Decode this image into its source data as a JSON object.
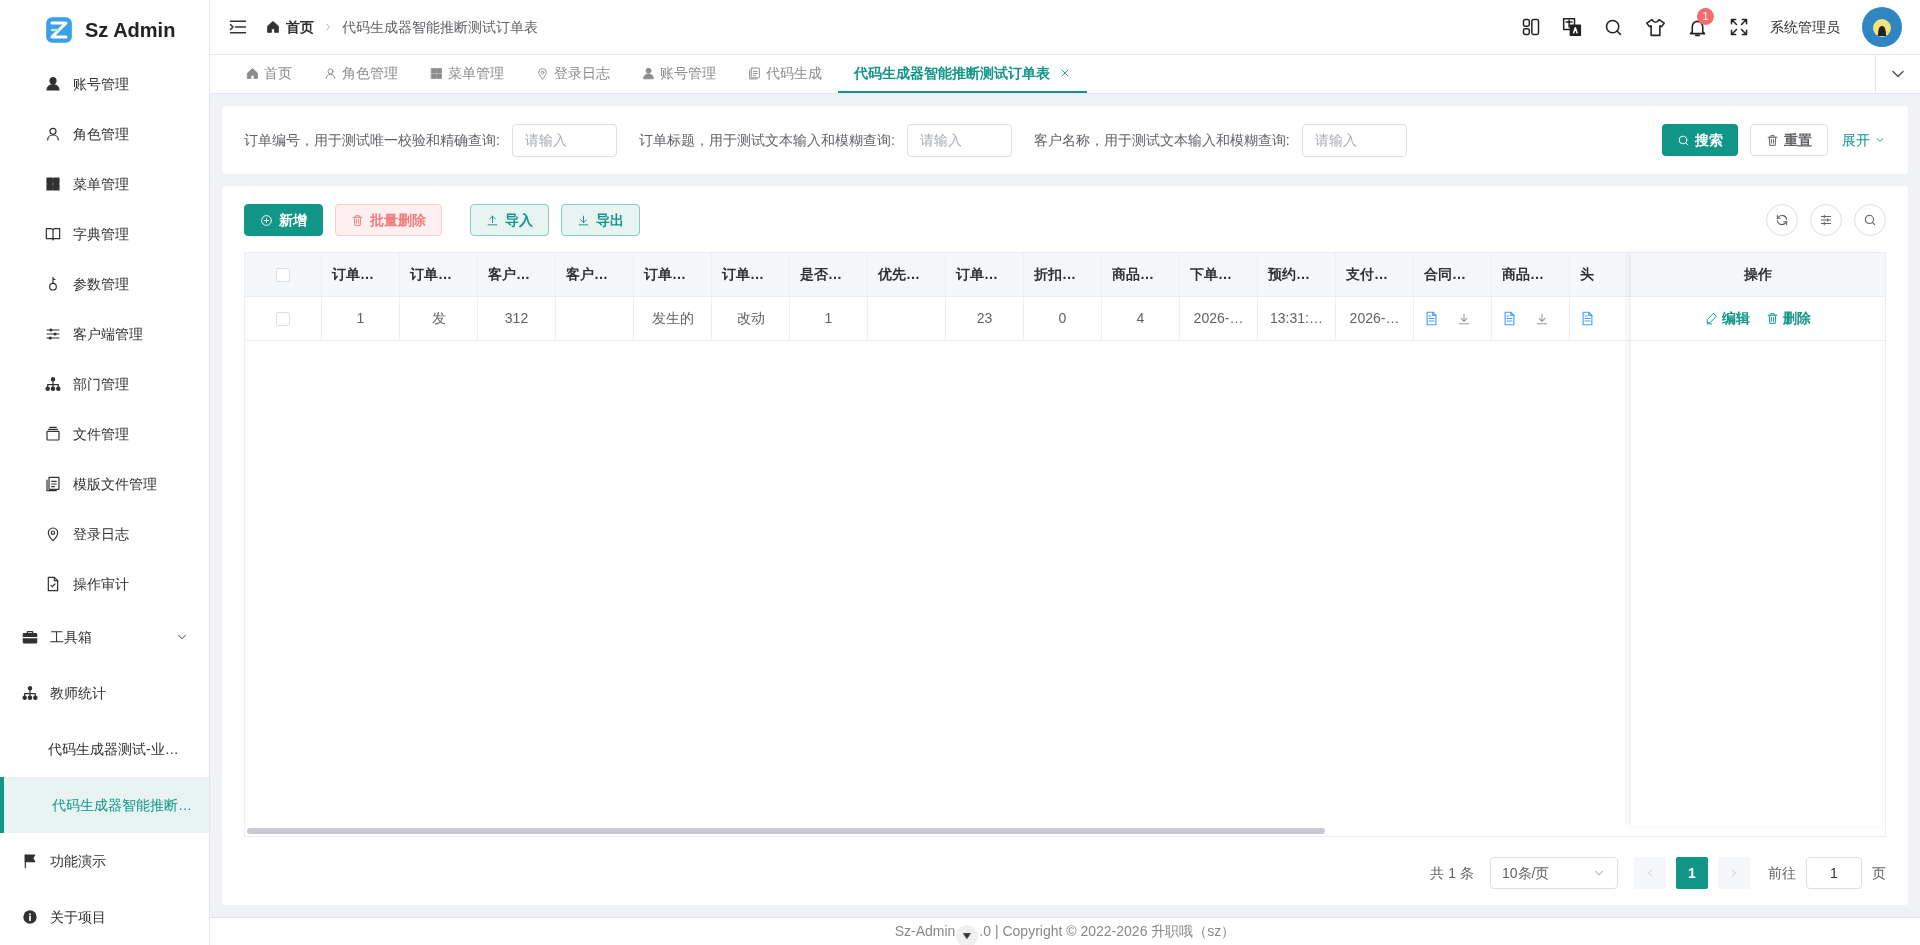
{
  "brand": {
    "name": "Sz Admin"
  },
  "sidebar": {
    "items": [
      {
        "children": [
          {
            "label": "账号管理"
          },
          {
            "label": "角色管理"
          },
          {
            "label": "菜单管理"
          },
          {
            "label": "字典管理"
          },
          {
            "label": "参数管理"
          },
          {
            "label": "客户端管理"
          },
          {
            "label": "部门管理"
          },
          {
            "label": "文件管理"
          },
          {
            "label": "模版文件管理"
          },
          {
            "label": "登录日志"
          },
          {
            "label": "操作审计"
          }
        ]
      },
      {
        "label": "工具箱",
        "expanded": false
      },
      {
        "label": "教师统计",
        "expanded": true,
        "children": [
          {
            "label": "代码生成器测试-业…",
            "selected": false
          },
          {
            "label": "代码生成器智能推断…",
            "selected": true
          }
        ]
      },
      {
        "label": "功能演示"
      },
      {
        "label": "关于项目"
      }
    ]
  },
  "header": {
    "breadcrumb": [
      "首页",
      "代码生成器智能推断测试订单表"
    ],
    "notification_count": "1",
    "user": "系统管理员"
  },
  "tabs": [
    {
      "label": "首页",
      "selected": false
    },
    {
      "label": "角色管理",
      "selected": false
    },
    {
      "label": "菜单管理",
      "selected": false
    },
    {
      "label": "登录日志",
      "selected": false
    },
    {
      "label": "账号管理",
      "selected": false
    },
    {
      "label": "代码生成",
      "selected": false
    },
    {
      "label": "代码生成器智能推断测试订单表",
      "selected": true
    }
  ],
  "search": {
    "fields": [
      {
        "label": "订单编号，用于测试唯一校验和精确查询:",
        "placeholder": "请输入"
      },
      {
        "label": "订单标题，用于测试文本输入和模糊查询:",
        "placeholder": "请输入"
      },
      {
        "label": "客户名称，用于测试文本输入和模糊查询:",
        "placeholder": "请输入"
      }
    ],
    "search_button": "搜索",
    "reset_button": "重置",
    "expand_link": "展开"
  },
  "toolbar": [
    {
      "label": "新增",
      "kind": "primary",
      "disabled": false
    },
    {
      "label": "批量删除",
      "kind": "danger",
      "disabled": true
    },
    {
      "label": "导入",
      "kind": "plain",
      "disabled": false
    },
    {
      "label": "导出",
      "kind": "plain",
      "disabled": false
    }
  ],
  "table": {
    "select_all_checked": false,
    "columns": [
      "订单…",
      "订单…",
      "客户…",
      "客户…",
      "订单…",
      "订单…",
      "是否…",
      "优先…",
      "订单…",
      "折扣…",
      "商品…",
      "下单…",
      "预约…",
      "支付…",
      "合同…",
      "商品…",
      "头"
    ],
    "actions_column": "操作",
    "rows": [
      {
        "checked": false,
        "cells": [
          {
            "kind": "text",
            "text": "1"
          },
          {
            "kind": "text",
            "text": "发"
          },
          {
            "kind": "text",
            "text": "312"
          },
          {
            "kind": "empty"
          },
          {
            "kind": "text",
            "text": "发生的"
          },
          {
            "kind": "text",
            "text": "改动"
          },
          {
            "kind": "text",
            "text": "1"
          },
          {
            "kind": "empty"
          },
          {
            "kind": "text",
            "text": "23"
          },
          {
            "kind": "text",
            "text": "0"
          },
          {
            "kind": "text",
            "text": "4"
          },
          {
            "kind": "text",
            "text": "2026-…"
          },
          {
            "kind": "text",
            "text": "13:31:…"
          },
          {
            "kind": "text",
            "text": "2026-…"
          },
          {
            "kind": "file"
          },
          {
            "kind": "file"
          },
          {
            "kind": "file_cut"
          }
        ],
        "actions": [
          "编辑",
          "删除"
        ]
      }
    ]
  },
  "pagination": {
    "total": "共 1 条",
    "page_size": "10条/页",
    "pages": [
      {
        "label": "1",
        "selected": true
      }
    ],
    "goto_label": "前往",
    "goto_value": "1",
    "page_suffix": "页"
  },
  "footer": {
    "text_before": "Sz-Admin",
    "text_after": ".0 | Copyright © 2022-2026 升职哦（sz）"
  }
}
